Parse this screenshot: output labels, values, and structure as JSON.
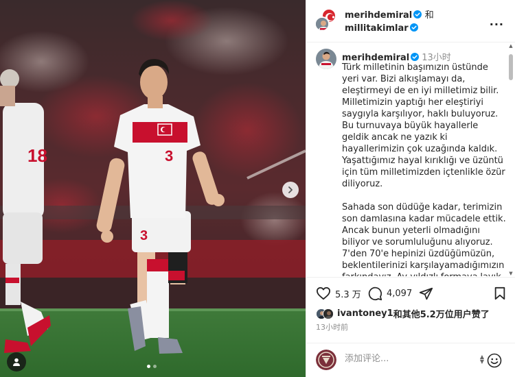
{
  "header": {
    "user1": "merihdemiral",
    "joiner": "和",
    "user2": "millitakimlar",
    "more_label": "..."
  },
  "caption": {
    "username": "merihdemiral",
    "time": "13小时",
    "text": "Türk milletinin başımızın üstünde yeri var. Bizi alkışlamayı da, eleştirmeyi de en iyi milletimiz bilir. Milletimizin yaptığı her eleştiriyi saygıyla karşılıyor, haklı buluyoruz. Bu turnuvaya büyük hayallerle geldik ancak ne yazık ki hayallerimizin çok uzağında kaldık. Yaşattığımız hayal kırıklığı ve üzüntü için tüm milletimizden içtenlikle özür diliyoruz.\n\nSahada son düdüğe kadar, terimizin son damlasına kadar mücadele ettik. Ancak bunun yeterli olmadığını biliyor ve sorumluluğunu alıyoruz. 7'den 70'e hepinizi üzdüğümüzün, beklentilerinizi karşılayamadığımızın farkındayız. Ay-yıldızlı formaya layık"
  },
  "actions": {
    "likes_count": "5.3 万",
    "comments_count": "4,097"
  },
  "liked_by": {
    "user": "ivantoney1",
    "rest": "和其他5.2万位用户赞了"
  },
  "posted_time": "13小时前",
  "comment_box": {
    "placeholder": "添加评论..."
  },
  "carousel": {
    "slide_count": 2,
    "active_index": 0
  },
  "jersey": {
    "player_number": "3",
    "other_number": "18"
  },
  "colors": {
    "accent_blue": "#0095f6",
    "jersey_red": "#c8102e"
  }
}
